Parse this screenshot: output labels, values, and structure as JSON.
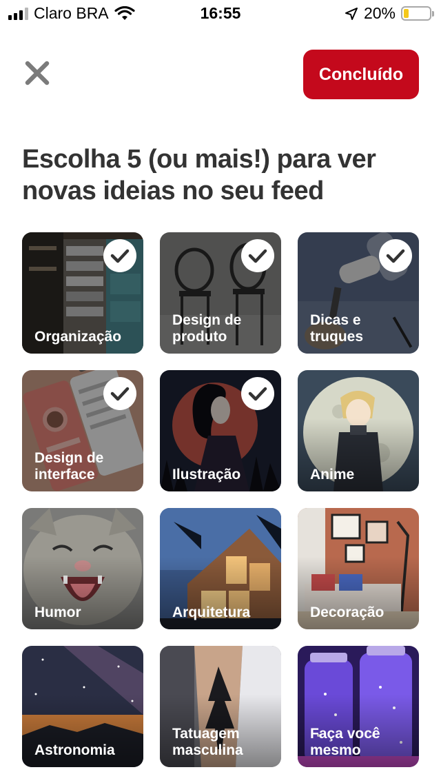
{
  "status_bar": {
    "carrier": "Claro BRA",
    "time": "16:55",
    "battery": "20%",
    "battery_level": 0.2
  },
  "header": {
    "close_icon": "close-icon",
    "done_label": "Concluído"
  },
  "heading": "Escolha 5 (ou mais!) para ver novas ideias no seu feed",
  "topics": [
    {
      "label": "Organização",
      "selected": true
    },
    {
      "label": "Design de\nproduto",
      "selected": true
    },
    {
      "label": "Dicas e\ntruques",
      "selected": true
    },
    {
      "label": "Design de\ninterface",
      "selected": true
    },
    {
      "label": "Ilustração",
      "selected": true
    },
    {
      "label": "Anime",
      "selected": false
    },
    {
      "label": "Humor",
      "selected": false
    },
    {
      "label": "Arquitetura",
      "selected": false
    },
    {
      "label": "Decoração",
      "selected": false
    },
    {
      "label": "Astronomia",
      "selected": false
    },
    {
      "label": "Tatuagem\nmasculina",
      "selected": false
    },
    {
      "label": "Faça você\nmesmo",
      "selected": false
    }
  ],
  "colors": {
    "accent": "#c4091c",
    "heading": "#333333",
    "battery_fill": "#f4c81b"
  }
}
